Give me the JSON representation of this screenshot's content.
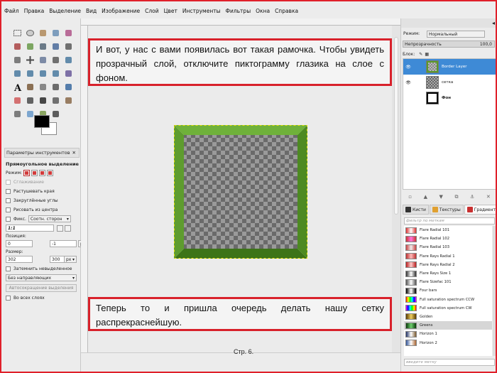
{
  "menu": [
    "Файл",
    "Правка",
    "Выделение",
    "Вид",
    "Изображение",
    "Слой",
    "Цвет",
    "Инструменты",
    "Фильтры",
    "Окна",
    "Справка"
  ],
  "tools": [
    "rect-select",
    "ellipse-select",
    "lasso",
    "fuzzy-select",
    "color-select",
    "scissors",
    "foreground-select",
    "paths",
    "color-picker",
    "zoom",
    "measure",
    "move",
    "align",
    "crop",
    "rotate",
    "scale",
    "shear",
    "perspective",
    "flip",
    "cage",
    "text",
    "bucket-fill",
    "blend",
    "pencil",
    "paintbrush",
    "eraser",
    "airbrush",
    "ink",
    "clone",
    "heal",
    "perspective-clone",
    "blur",
    "smudge",
    "dodge"
  ],
  "tool_options": {
    "tab_title": "Параметры инструментов",
    "title": "Прямоугольное выделение",
    "mode_label": "Режим:",
    "antialias": "Сглаживание",
    "feather": "Растушевать края",
    "rounded": "Закруглённые углы",
    "from_center": "Рисовать из центра",
    "fixed_label": "Фикс.",
    "fixed_value": "Соотн. сторон",
    "ratio": "1:1",
    "position_label": "Позиция:",
    "position_unit": "px",
    "pos_x": "0",
    "pos_y": "-1",
    "size_label": "Размер:",
    "size_unit": "px",
    "size_w": "302",
    "size_h": "300",
    "highlight": "Затемнить невыделенное",
    "guides": "Без направляющих",
    "autoshrink": "Автосокращение выделения",
    "sample_merged": "Во всех слоях"
  },
  "layers": {
    "mode_label": "Режим:",
    "mode_value": "Нормальный",
    "opacity_label": "Непрозрачность",
    "opacity_value": "100,0",
    "lock_label": "Блок:",
    "items": [
      {
        "name": "Border Layer",
        "selected": true,
        "visible": true
      },
      {
        "name": "сетка",
        "selected": false,
        "visible": true
      },
      {
        "name": "Фон",
        "selected": false,
        "visible": false
      }
    ]
  },
  "gradients": {
    "tabs": [
      "Кисти",
      "Текстуры",
      "Градиенты"
    ],
    "filter_placeholder": "фильтр по меткам",
    "search_placeholder": "введите метку",
    "items": [
      {
        "name": "Flare Radial 101",
        "colors": [
          "#d33",
          "#fff",
          "#d33"
        ]
      },
      {
        "name": "Flare Radial 102",
        "colors": [
          "#c33",
          "#f7d",
          "#c33"
        ]
      },
      {
        "name": "Flare Radial 103",
        "colors": [
          "#c44",
          "#eee",
          "#c44"
        ]
      },
      {
        "name": "Flare Rays Radial 1",
        "colors": [
          "#b33",
          "#fbb",
          "#b33"
        ]
      },
      {
        "name": "Flare Rays Radial 2",
        "colors": [
          "#b22",
          "#fcc",
          "#b22"
        ]
      },
      {
        "name": "Flare Rays Size 1",
        "colors": [
          "#333",
          "#fff",
          "#333"
        ]
      },
      {
        "name": "Flare Sizefac 101",
        "colors": [
          "#555",
          "#fff",
          "#555"
        ]
      },
      {
        "name": "Four bars",
        "colors": [
          "#000",
          "#fff",
          "#000"
        ]
      },
      {
        "name": "Full saturation spectrum CCW",
        "colors": [
          "#f00",
          "#ff0",
          "#0f0",
          "#0ff",
          "#00f",
          "#f0f"
        ]
      },
      {
        "name": "Full saturation spectrum CW",
        "colors": [
          "#f0f",
          "#00f",
          "#0ff",
          "#0f0",
          "#ff0",
          "#f00"
        ]
      },
      {
        "name": "Golden",
        "colors": [
          "#5a3b00",
          "#f0d060",
          "#5a3b00"
        ]
      },
      {
        "name": "Greens",
        "colors": [
          "#0a3a0a",
          "#6fcf6f",
          "#0a3a0a"
        ]
      },
      {
        "name": "Horizon 1",
        "colors": [
          "#223366",
          "#ffffff",
          "#7a5a30"
        ]
      },
      {
        "name": "Horizon 2",
        "colors": [
          "#335599",
          "#ffffff",
          "#aa6633"
        ]
      }
    ],
    "selected_index": 11
  },
  "annotation_top": "И вот, у нас с вами появилась вот такая рамочка. Чтобы увидеть прозрачный слой, отключите пиктограмму глазика на слое с фоном.",
  "annotation_bottom": "Теперь то и пришла очередь делать нашу сетку распрекраснейшую.",
  "page_number": "Стр. 6.",
  "colors": {
    "frame_green": "#5a9a2a",
    "frame_red": "#d8212b",
    "selected_layer": "#3e8ad6"
  }
}
